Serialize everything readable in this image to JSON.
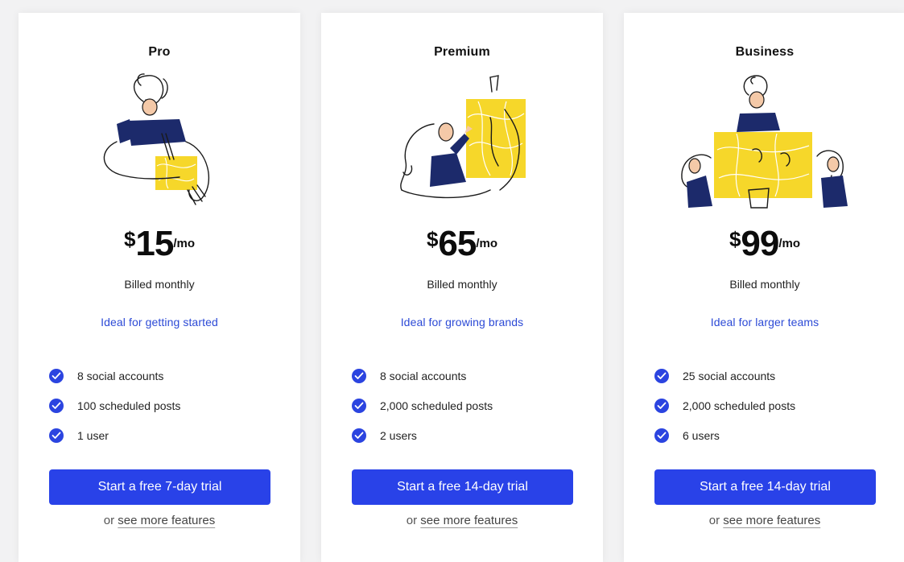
{
  "plans": [
    {
      "name": "Pro",
      "currency": "$",
      "amount": "15",
      "period": "/mo",
      "billing": "Billed monthly",
      "ideal": "Ideal for getting started",
      "features": [
        "8 social accounts",
        "100 scheduled posts",
        "1 user"
      ],
      "cta": "Start a free 7-day trial",
      "more_prefix": "or",
      "more_link": "see more features"
    },
    {
      "name": "Premium",
      "currency": "$",
      "amount": "65",
      "period": "/mo",
      "billing": "Billed monthly",
      "ideal": "Ideal for growing brands",
      "features": [
        "8 social accounts",
        "2,000 scheduled posts",
        "2 users"
      ],
      "cta": "Start a free 14-day trial",
      "more_prefix": "or",
      "more_link": "see more features"
    },
    {
      "name": "Business",
      "currency": "$",
      "amount": "99",
      "period": "/mo",
      "billing": "Billed monthly",
      "ideal": "Ideal for larger teams",
      "features": [
        "25 social accounts",
        "2,000 scheduled posts",
        "6 users"
      ],
      "cta": "Start a free 14-day trial",
      "more_prefix": "or",
      "more_link": "see more features"
    }
  ],
  "colors": {
    "accent": "#2942e8",
    "ideal_text": "#2c4ad6",
    "illustration_yellow": "#f6d72a",
    "illustration_navy": "#1c2a6b",
    "skin": "#f4c9a8"
  },
  "icons": {
    "check": "check-circle-icon"
  }
}
